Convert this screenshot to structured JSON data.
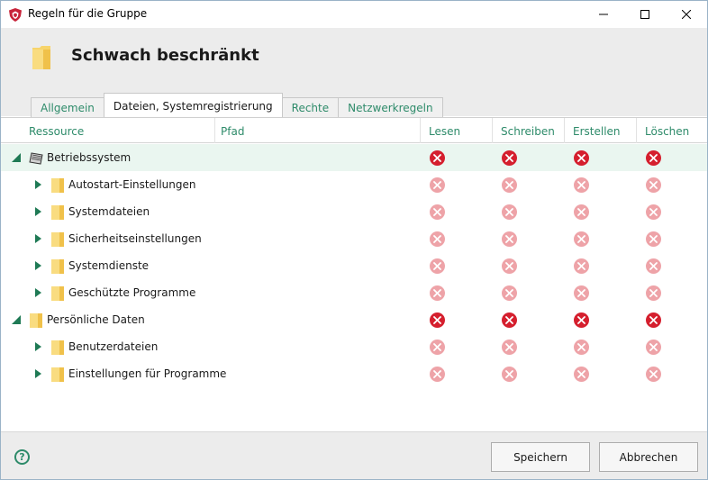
{
  "window": {
    "title": "Regeln für die Gruppe",
    "icon": "shield-icon",
    "controls": [
      "minimize-icon",
      "maximize-icon",
      "close-icon"
    ]
  },
  "header": {
    "heading": "Schwach beschränkt",
    "icon": "folder-icon"
  },
  "tabs": [
    {
      "label": "Allgemein",
      "active": false
    },
    {
      "label": "Dateien, Systemregistrierung",
      "active": true
    },
    {
      "label": "Rechte",
      "active": false
    },
    {
      "label": "Netzwerkregeln",
      "active": false
    }
  ],
  "table": {
    "columns": {
      "resource": "Ressource",
      "path": "Pfad",
      "read": "Lesen",
      "write": "Schreiben",
      "create": "Erstellen",
      "delete": "Löschen"
    },
    "rows": [
      {
        "label": "Betriebssystem",
        "level": 0,
        "expanded": true,
        "icon": "chip-icon",
        "path": "",
        "permissions": [
          "deny",
          "deny",
          "deny",
          "deny"
        ],
        "inherited": false,
        "selected": true
      },
      {
        "label": "Autostart-Einstellungen",
        "level": 1,
        "expanded": false,
        "icon": "folder-icon",
        "path": "",
        "permissions": [
          "deny",
          "deny",
          "deny",
          "deny"
        ],
        "inherited": true,
        "selected": false
      },
      {
        "label": "Systemdateien",
        "level": 1,
        "expanded": false,
        "icon": "folder-icon",
        "path": "",
        "permissions": [
          "deny",
          "deny",
          "deny",
          "deny"
        ],
        "inherited": true,
        "selected": false
      },
      {
        "label": "Sicherheitseinstellungen",
        "level": 1,
        "expanded": false,
        "icon": "folder-icon",
        "path": "",
        "permissions": [
          "deny",
          "deny",
          "deny",
          "deny"
        ],
        "inherited": true,
        "selected": false
      },
      {
        "label": "Systemdienste",
        "level": 1,
        "expanded": false,
        "icon": "folder-icon",
        "path": "",
        "permissions": [
          "deny",
          "deny",
          "deny",
          "deny"
        ],
        "inherited": true,
        "selected": false
      },
      {
        "label": "Geschützte Programme",
        "level": 1,
        "expanded": false,
        "icon": "folder-icon",
        "path": "",
        "permissions": [
          "deny",
          "deny",
          "deny",
          "deny"
        ],
        "inherited": true,
        "selected": false
      },
      {
        "label": "Persönliche Daten",
        "level": 0,
        "expanded": true,
        "icon": "folder-icon",
        "path": "",
        "permissions": [
          "deny",
          "deny",
          "deny",
          "deny"
        ],
        "inherited": false,
        "selected": false
      },
      {
        "label": "Benutzerdateien",
        "level": 1,
        "expanded": false,
        "icon": "folder-icon",
        "path": "",
        "permissions": [
          "deny",
          "deny",
          "deny",
          "deny"
        ],
        "inherited": true,
        "selected": false
      },
      {
        "label": "Einstellungen für Programme",
        "level": 1,
        "expanded": false,
        "icon": "folder-icon",
        "path": "",
        "permissions": [
          "deny",
          "deny",
          "deny",
          "deny"
        ],
        "inherited": true,
        "selected": false
      }
    ]
  },
  "footer": {
    "help_icon": "help-icon",
    "help_glyph": "?",
    "save_label": "Speichern",
    "cancel_label": "Abbrechen"
  },
  "colors": {
    "accent": "#2e8b6a",
    "deny_strong": "#d51f2e",
    "deny_weak": "#eea3a8",
    "folder": "#f7d46b",
    "selected_row": "#eaf6f0"
  }
}
